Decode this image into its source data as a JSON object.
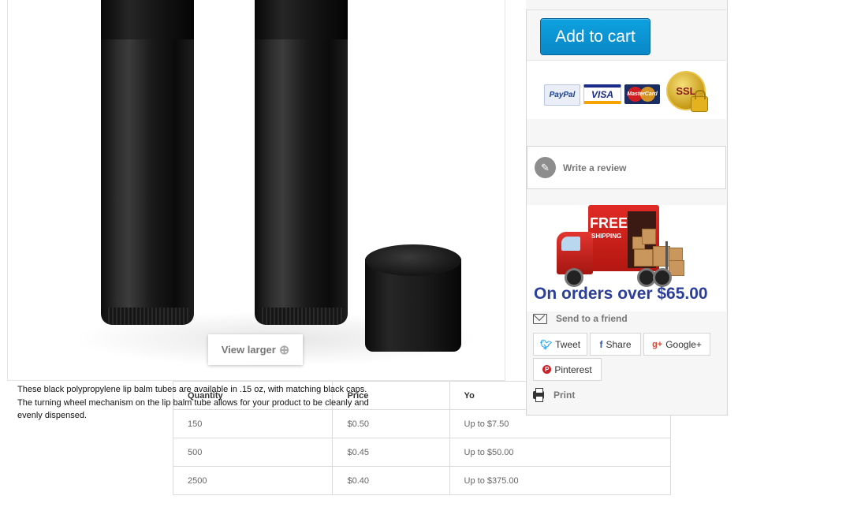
{
  "product_image": {
    "view_larger_label": "View larger",
    "zoom_icon": "magnify-plus-icon"
  },
  "description": {
    "lines": [
      "These black polypropylene lip balm tubes are available in .15 oz, with matching black caps.",
      "The turning wheel mechanism on the lip balm tube allows for your product to be cleanly and",
      "evenly dispensed."
    ]
  },
  "quantity_table": {
    "headers": [
      "Quantity",
      "Price",
      "Yo"
    ],
    "rows": [
      [
        "150",
        "$0.50",
        "Up to $7.50"
      ],
      [
        "500",
        "$0.45",
        "Up to $50.00"
      ],
      [
        "2500",
        "$0.40",
        "Up to $375.00"
      ]
    ]
  },
  "sidebar": {
    "add_to_cart_label": "Add to cart",
    "payment": {
      "paypal": "PayPal",
      "visa": "VISA",
      "mastercard": "MasterCard",
      "ssl": "SSL"
    },
    "write_review_label": "Write a review",
    "free_shipping": {
      "free": "FREE",
      "shipping": "SHIPPING",
      "orders_over": "On orders over $65.00"
    },
    "send_to_friend_label": "Send to a friend",
    "share": {
      "tweet": "Tweet",
      "share": "Share",
      "google_plus": "Google+",
      "pinterest": "Pinterest"
    },
    "print_label": "Print"
  },
  "colors": {
    "button_blue": "#0a87c6",
    "free_shipping_text": "#2b3f9a",
    "truck_red": "#d4211c"
  }
}
